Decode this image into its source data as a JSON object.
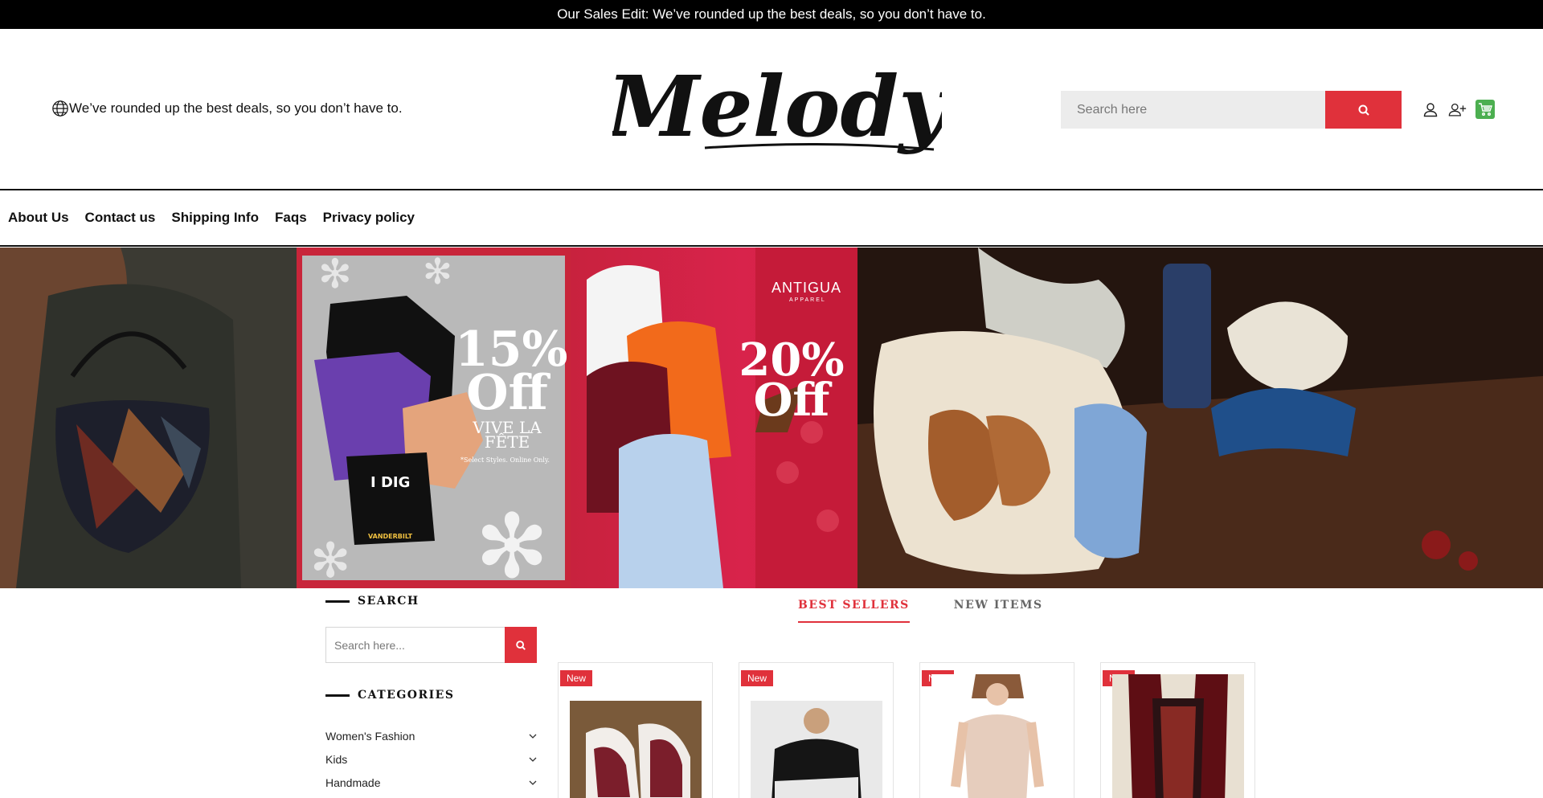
{
  "announcement": "Our Sales Edit: We’ve rounded up the best deals, so you don’t have to.",
  "header": {
    "tagline": "We’ve rounded up the best deals, so you don’t have to.",
    "logo_text": "Melody",
    "search_placeholder": "Search here",
    "icons": [
      "globe-icon",
      "search-icon",
      "user-icon",
      "add-user-icon",
      "cart-icon"
    ]
  },
  "nav": {
    "items": [
      "About Us",
      "Contact us",
      "Shipping Info",
      "Faqs",
      "Privacy policy"
    ]
  },
  "hero": {
    "promo1": {
      "big": "15% Off",
      "line": "VIVE LA FÊTE",
      "note": "*Select Styles. Online Only."
    },
    "promo2": {
      "big": "20% Off",
      "brand": "ANTIGUA",
      "brand_sub": "APPAREL"
    },
    "shirt_text": "I DIG",
    "shirt_sub": "VANDERBILT"
  },
  "sidebar": {
    "search_title": "SEARCH",
    "search_placeholder": "Search here...",
    "categories_title": "CATEGORIES",
    "categories": [
      "Women's Fashion",
      "Kids",
      "Handmade"
    ]
  },
  "tabs": [
    {
      "label": "BEST SELLERS",
      "active": true
    },
    {
      "label": "NEW ITEMS",
      "active": false
    }
  ],
  "products": [
    {
      "badge": "New",
      "image": "sneakers"
    },
    {
      "badge": "New",
      "image": "jacket"
    },
    {
      "badge": "New",
      "image": "bodysuit"
    },
    {
      "badge": "New",
      "image": "scarf-vest"
    }
  ],
  "colors": {
    "accent": "#e0313b",
    "topbar": "#000000",
    "cart": "#4caf50"
  }
}
